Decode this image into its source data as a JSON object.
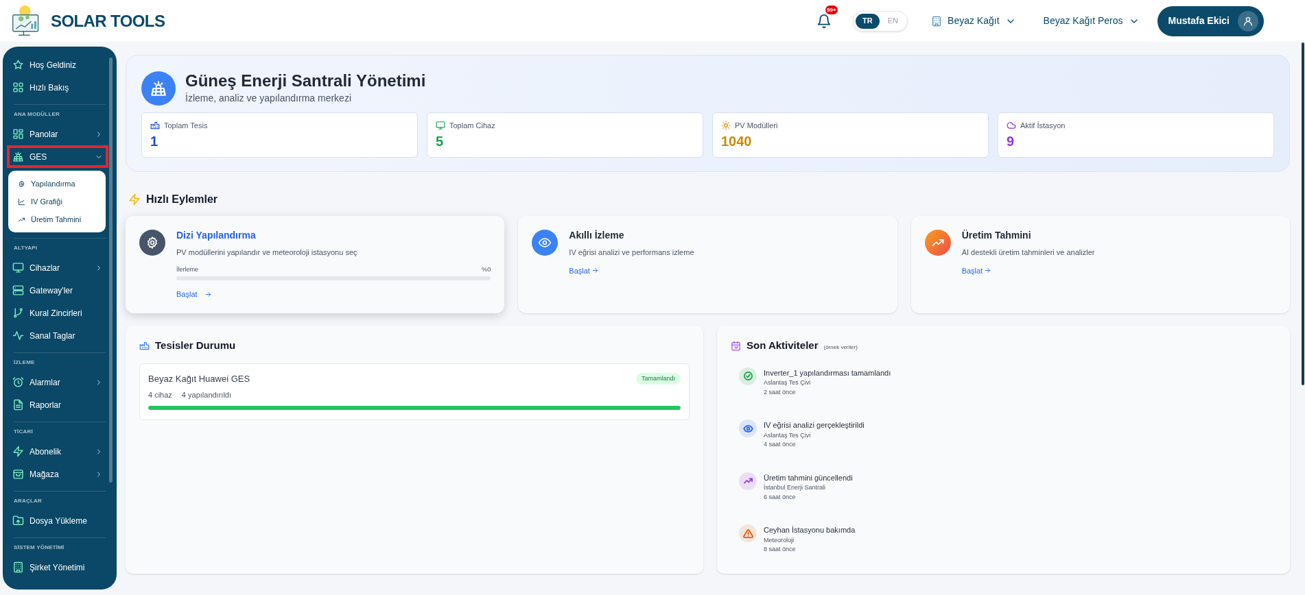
{
  "topbar": {
    "brand": "SOLAR TOOLS",
    "notification_badge": "99+",
    "languages": [
      {
        "label": "TR",
        "selected": true
      },
      {
        "label": "EN",
        "selected": false
      }
    ],
    "company": "Beyaz Kağıt",
    "site": "Beyaz Kağıt Peros",
    "user": "Mustafa Ekici"
  },
  "sidebar": {
    "sections": [
      {
        "items": [
          {
            "label": "Hoş Geldiniz",
            "kind": "star",
            "expandable": false
          },
          {
            "label": "Hızlı Bakış",
            "kind": "grid",
            "expandable": false
          }
        ]
      },
      {
        "title": "ANA MODÜLLER",
        "items": [
          {
            "label": "Panolar",
            "kind": "layout",
            "expandable": true,
            "expanded": false,
            "highlighted": false
          },
          {
            "label": "GES",
            "kind": "solar",
            "expandable": true,
            "expanded": true,
            "highlighted": true,
            "children": [
              {
                "label": "Yapılandırma",
                "kind": "gear"
              },
              {
                "label": "IV Grafiği",
                "kind": "chart"
              },
              {
                "label": "Üretim Tahmini",
                "kind": "trend"
              }
            ]
          }
        ]
      },
      {
        "title": "ALTYAPI",
        "items": [
          {
            "label": "Cihazlar",
            "kind": "monitor",
            "expandable": true,
            "expanded": false
          },
          {
            "label": "Gateway'ler",
            "kind": "server",
            "expandable": false
          },
          {
            "label": "Kural Zincirleri",
            "kind": "branch",
            "expandable": false
          },
          {
            "label": "Sanal Taglar",
            "kind": "pulse",
            "expandable": false
          }
        ]
      },
      {
        "title": "İZLEME",
        "items": [
          {
            "label": "Alarmlar",
            "kind": "alarm",
            "expandable": true,
            "expanded": false
          },
          {
            "label": "Raporlar",
            "kind": "file",
            "expandable": false
          }
        ]
      },
      {
        "title": "TİCARİ",
        "items": [
          {
            "label": "Abonelik",
            "kind": "bolt",
            "expandable": true,
            "expanded": false
          },
          {
            "label": "Mağaza",
            "kind": "bag",
            "expandable": true,
            "expanded": false
          }
        ]
      },
      {
        "title": "ARAÇLAR",
        "items": [
          {
            "label": "Dosya Yükleme",
            "kind": "upload",
            "expandable": false
          }
        ]
      },
      {
        "title": "SİSTEM YÖNETİMİ",
        "items": [
          {
            "label": "Şirket Yönetimi",
            "kind": "building",
            "expandable": false
          }
        ]
      }
    ]
  },
  "header": {
    "title": "Güneş Enerji Santrali Yönetimi",
    "subtitle": "İzleme, analiz ve yapılandırma merkezi",
    "stats": [
      {
        "label": "Toplam Tesis",
        "value": "1",
        "kind": "factory",
        "color": "#1d4ed8"
      },
      {
        "label": "Toplam Cihaz",
        "value": "5",
        "kind": "monitor",
        "color": "#16a34a"
      },
      {
        "label": "PV Modülleri",
        "value": "1040",
        "kind": "sun",
        "color": "#ca8a04"
      },
      {
        "label": "Aktif İstasyon",
        "value": "9",
        "kind": "cloud",
        "color": "#9333ea"
      }
    ]
  },
  "quick_actions": {
    "title": "Hızlı Eylemler",
    "cards": [
      {
        "title": "Dizi Yapılandırma",
        "description": "PV modüllerini yapılandır ve meteoroloji istasyonu seç",
        "kind": "gear",
        "hovered": true,
        "progress": {
          "label": "İlerleme",
          "reading": "%0",
          "level": 0
        },
        "link": "Başlat"
      },
      {
        "title": "Akıllı İzleme",
        "description": "IV eğrisi analizi ve performans izleme",
        "kind": "eye",
        "hovered": false,
        "link": "Başlat"
      },
      {
        "title": "Üretim Tahmini",
        "description": "AI destekli üretim tahminleri ve analizler",
        "kind": "trend",
        "hovered": false,
        "link": "Başlat"
      }
    ]
  },
  "facilities": {
    "title": "Tesisler Durumu",
    "items": [
      {
        "name": "Beyaz Kağıt Huawei GES",
        "status": "Tamamlandı",
        "devices": "4 cihaz",
        "configured": "4 yapılandırıldı",
        "level": 1
      }
    ]
  },
  "activities": {
    "title": "Son Aktiviteler",
    "note": "(örnek veriler)",
    "items": [
      {
        "title": "Inverter_1 yapılandırması tamamlandı",
        "place": "Aslantaş Tes Çivi",
        "time": "2 saat önce",
        "kind": "check",
        "color": "#16a34a"
      },
      {
        "title": "IV eğrisi analizi gerçekleştirildi",
        "place": "Aslantaş Tes Çivi",
        "time": "4 saat önce",
        "kind": "eye",
        "color": "#2563eb"
      },
      {
        "title": "Üretim tahmini güncellendi",
        "place": "İstanbul Enerji Santrali",
        "time": "6 saat önce",
        "kind": "trend",
        "color": "#9333ea"
      },
      {
        "title": "Ceyhan İstasyonu bakımda",
        "place": "Meteoroloji",
        "time": "8 saat önce",
        "kind": "warning",
        "color": "#ea580c"
      }
    ]
  }
}
